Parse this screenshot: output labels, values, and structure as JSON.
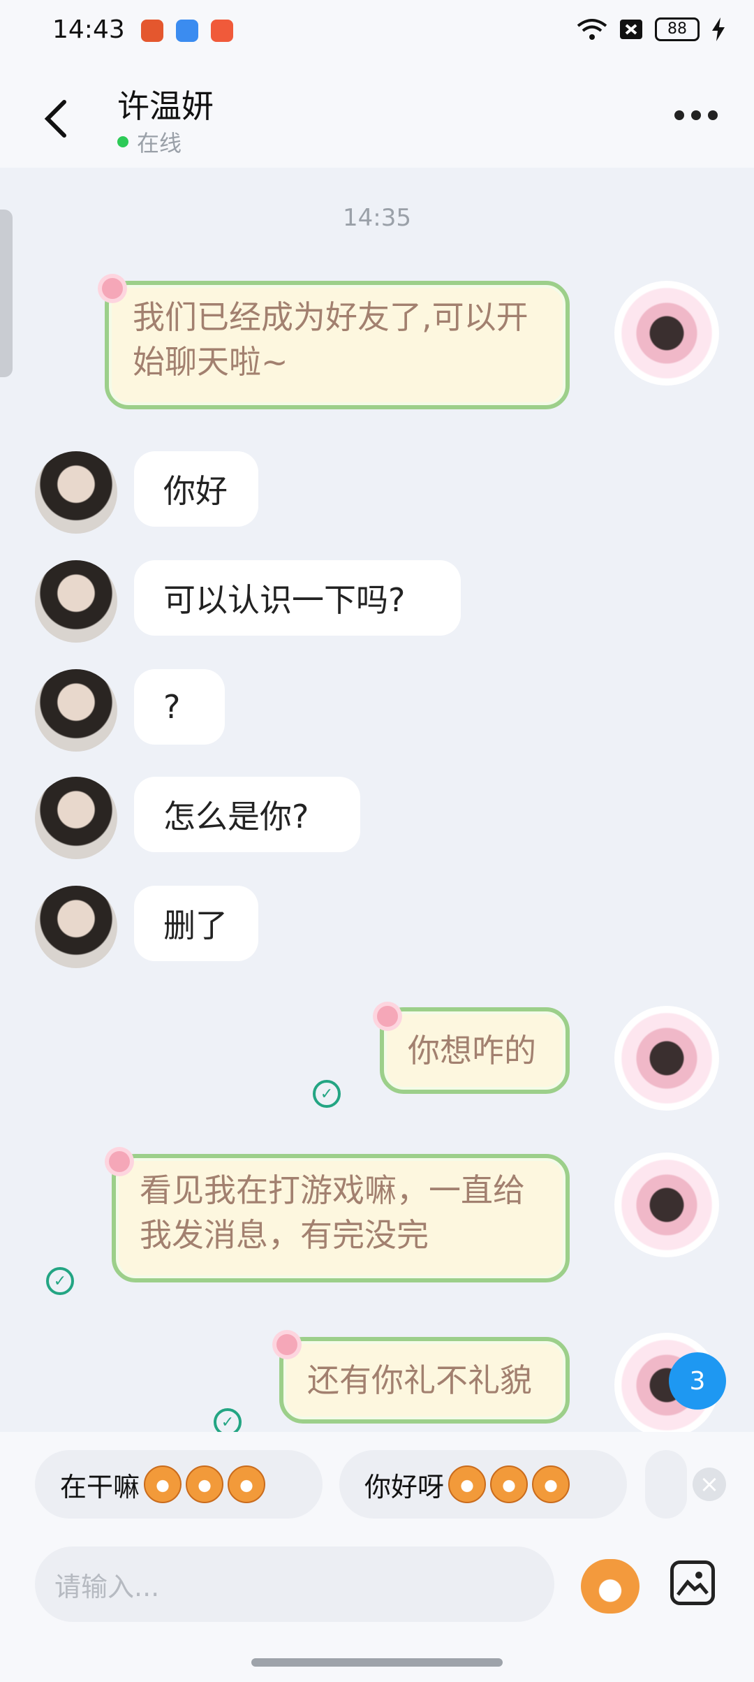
{
  "status_bar": {
    "time": "14:43",
    "battery": "88",
    "app_icons": [
      "app-icon-1",
      "app-icon-2",
      "app-icon-3"
    ]
  },
  "header": {
    "title": "许温妍",
    "status": "在线"
  },
  "chat": {
    "timestamp": "14:35",
    "messages": [
      {
        "side": "right",
        "text": "我们已经成为好友了,可以开始聊天啦~",
        "checked": false
      },
      {
        "side": "left",
        "text": "你好"
      },
      {
        "side": "left",
        "text": "可以认识一下吗?"
      },
      {
        "side": "left",
        "text": "?"
      },
      {
        "side": "left",
        "text": "怎么是你?"
      },
      {
        "side": "left",
        "text": "删了"
      },
      {
        "side": "right",
        "text": "你想咋的",
        "checked": true
      },
      {
        "side": "right",
        "text": "看见我在打游戏嘛，一直给我发消息，有完没完",
        "checked": true
      },
      {
        "side": "right",
        "text": "还有你礼不礼貌",
        "checked": true
      }
    ],
    "new_count_badge": "3"
  },
  "quick_replies": [
    {
      "text": "在干嘛"
    },
    {
      "text": "你好呀"
    }
  ],
  "input": {
    "placeholder": "请输入..."
  },
  "colors": {
    "accent_badge": "#1e98f2",
    "online_dot": "#2dca57",
    "check": "#23a583",
    "bubble_right_border": "#9ccf8a",
    "bubble_right_bg": "#fdf7df",
    "bubble_right_text": "#a2806f"
  }
}
